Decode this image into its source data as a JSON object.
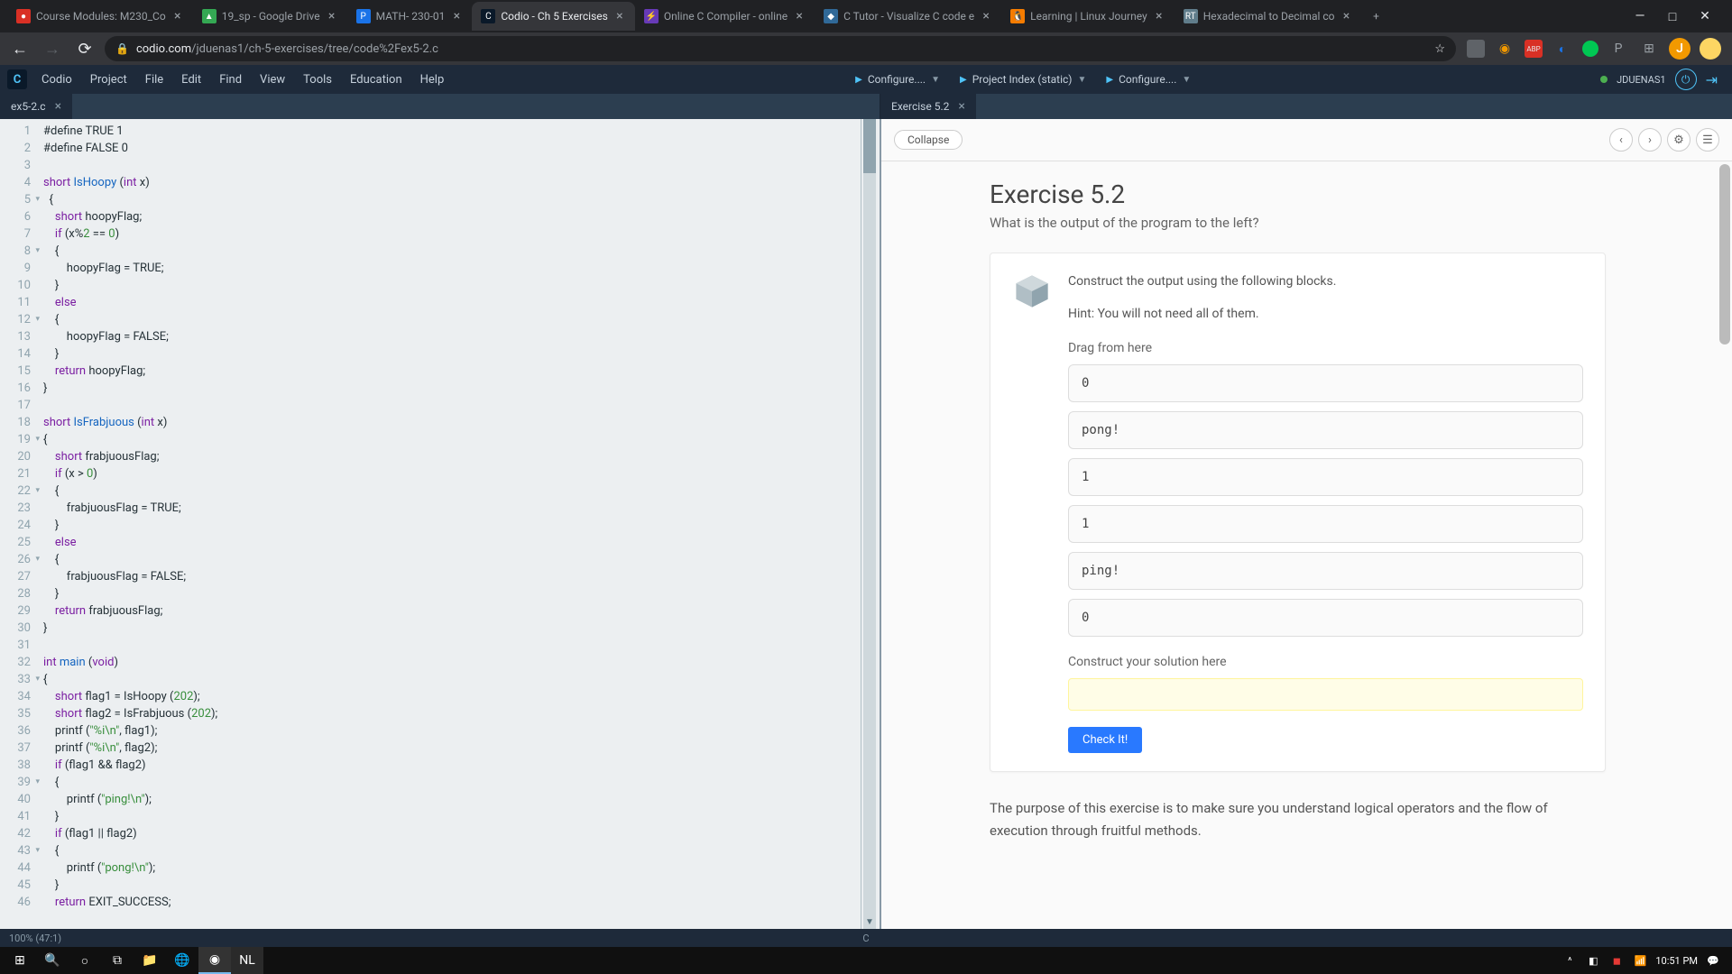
{
  "browser": {
    "tabs": [
      {
        "title": "Course Modules: M230_Co",
        "icon_bg": "#d93025",
        "icon_txt": "●"
      },
      {
        "title": "19_sp - Google Drive",
        "icon_bg": "#34a853",
        "icon_txt": "▲"
      },
      {
        "title": "MATH- 230-01",
        "icon_bg": "#1a73e8",
        "icon_txt": "P"
      },
      {
        "title": "Codio - Ch 5 Exercises",
        "icon_bg": "#0a1929",
        "icon_txt": "C",
        "active": true
      },
      {
        "title": "Online C Compiler - online",
        "icon_bg": "#673ab7",
        "icon_txt": "⚡"
      },
      {
        "title": "C Tutor - Visualize C code e",
        "icon_bg": "#306998",
        "icon_txt": "◆"
      },
      {
        "title": "Learning | Linux Journey",
        "icon_bg": "#f57c00",
        "icon_txt": "🐧"
      },
      {
        "title": "Hexadecimal to Decimal co",
        "icon_bg": "#607d8b",
        "icon_txt": "RT"
      }
    ],
    "url_domain": "codio.com",
    "url_path": "/jduenas1/ch-5-exercises/tree/code%2Fex5-2.c"
  },
  "codio": {
    "menu": [
      "Codio",
      "Project",
      "File",
      "Edit",
      "Find",
      "View",
      "Tools",
      "Education",
      "Help"
    ],
    "config1": "Configure....",
    "config2": "Project Index (static)",
    "config3": "Configure....",
    "username": "JDUENAS1"
  },
  "file_tabs": {
    "left": "ex5-2.c",
    "right": "Exercise 5.2"
  },
  "code": {
    "lines": [
      {
        "n": 1,
        "html": "#define TRUE 1"
      },
      {
        "n": 2,
        "html": "#define FALSE 0"
      },
      {
        "n": 3,
        "html": ""
      },
      {
        "n": 4,
        "html": "<span class='type'>short</span> <span class='fn'>IsHoopy</span> (<span class='type'>int</span> x)"
      },
      {
        "n": 5,
        "fold": true,
        "html": "  {"
      },
      {
        "n": 6,
        "html": "    <span class='type'>short</span> hoopyFlag;"
      },
      {
        "n": 7,
        "html": "    <span class='kw'>if</span> (x%<span class='num'>2</span> == <span class='num'>0</span>)"
      },
      {
        "n": 8,
        "fold": true,
        "html": "    {"
      },
      {
        "n": 9,
        "html": "        hoopyFlag = TRUE;"
      },
      {
        "n": 10,
        "html": "    }"
      },
      {
        "n": 11,
        "html": "    <span class='kw'>else</span>"
      },
      {
        "n": 12,
        "fold": true,
        "html": "    {"
      },
      {
        "n": 13,
        "html": "        hoopyFlag = FALSE;"
      },
      {
        "n": 14,
        "html": "    }"
      },
      {
        "n": 15,
        "html": "    <span class='kw'>return</span> hoopyFlag;"
      },
      {
        "n": 16,
        "html": "}"
      },
      {
        "n": 17,
        "html": ""
      },
      {
        "n": 18,
        "html": "<span class='type'>short</span> <span class='fn'>IsFrabjuous</span> (<span class='type'>int</span> x)"
      },
      {
        "n": 19,
        "fold": true,
        "html": "{"
      },
      {
        "n": 20,
        "html": "    <span class='type'>short</span> frabjuousFlag;"
      },
      {
        "n": 21,
        "html": "    <span class='kw'>if</span> (x > <span class='num'>0</span>)"
      },
      {
        "n": 22,
        "fold": true,
        "html": "    {"
      },
      {
        "n": 23,
        "html": "        frabjuousFlag = TRUE;"
      },
      {
        "n": 24,
        "html": "    }"
      },
      {
        "n": 25,
        "html": "    <span class='kw'>else</span>"
      },
      {
        "n": 26,
        "fold": true,
        "html": "    {"
      },
      {
        "n": 27,
        "html": "        frabjuousFlag = FALSE;"
      },
      {
        "n": 28,
        "html": "    }"
      },
      {
        "n": 29,
        "html": "    <span class='kw'>return</span> frabjuousFlag;"
      },
      {
        "n": 30,
        "html": "}"
      },
      {
        "n": 31,
        "html": ""
      },
      {
        "n": 32,
        "html": "<span class='type'>int</span> <span class='fn'>main</span> (<span class='type'>void</span>)"
      },
      {
        "n": 33,
        "fold": true,
        "html": "{"
      },
      {
        "n": 34,
        "html": "    <span class='type'>short</span> flag1 = IsHoopy (<span class='num'>202</span>);"
      },
      {
        "n": 35,
        "html": "    <span class='type'>short</span> flag2 = IsFrabjuous (<span class='num'>202</span>);"
      },
      {
        "n": 36,
        "html": "    printf (<span class='str'>\"%i\\n\"</span>, flag1);"
      },
      {
        "n": 37,
        "html": "    printf (<span class='str'>\"%i\\n\"</span>, flag2);"
      },
      {
        "n": 38,
        "html": "    <span class='kw'>if</span> (flag1 && flag2)"
      },
      {
        "n": 39,
        "fold": true,
        "html": "    {"
      },
      {
        "n": 40,
        "html": "        printf (<span class='str'>\"ping!\\n\"</span>);"
      },
      {
        "n": 41,
        "html": "    }"
      },
      {
        "n": 42,
        "html": "    <span class='kw'>if</span> (flag1 || flag2)"
      },
      {
        "n": 43,
        "fold": true,
        "html": "    {"
      },
      {
        "n": 44,
        "html": "        printf (<span class='str'>\"pong!\\n\"</span>);"
      },
      {
        "n": 45,
        "html": "    }"
      },
      {
        "n": 46,
        "html": "    <span class='kw'>return</span> EXIT_SUCCESS;"
      }
    ]
  },
  "exercise": {
    "collapse": "Collapse",
    "title": "Exercise 5.2",
    "subtitle": "What is the output of the program to the left?",
    "instruction": "Construct the output using the following blocks.",
    "hint": "Hint: You will not need all of them.",
    "drag_label": "Drag from here",
    "blocks": [
      "0",
      "pong!",
      "1",
      "1",
      "ping!",
      "0"
    ],
    "solution_label": "Construct your solution here",
    "check_btn": "Check It!",
    "footer": "The purpose of this exercise is to make sure you understand logical operators and the flow of execution through fruitful methods."
  },
  "status": {
    "left": "100%   (47:1)",
    "lang": "C"
  },
  "taskbar": {
    "time": "10:51 PM"
  }
}
